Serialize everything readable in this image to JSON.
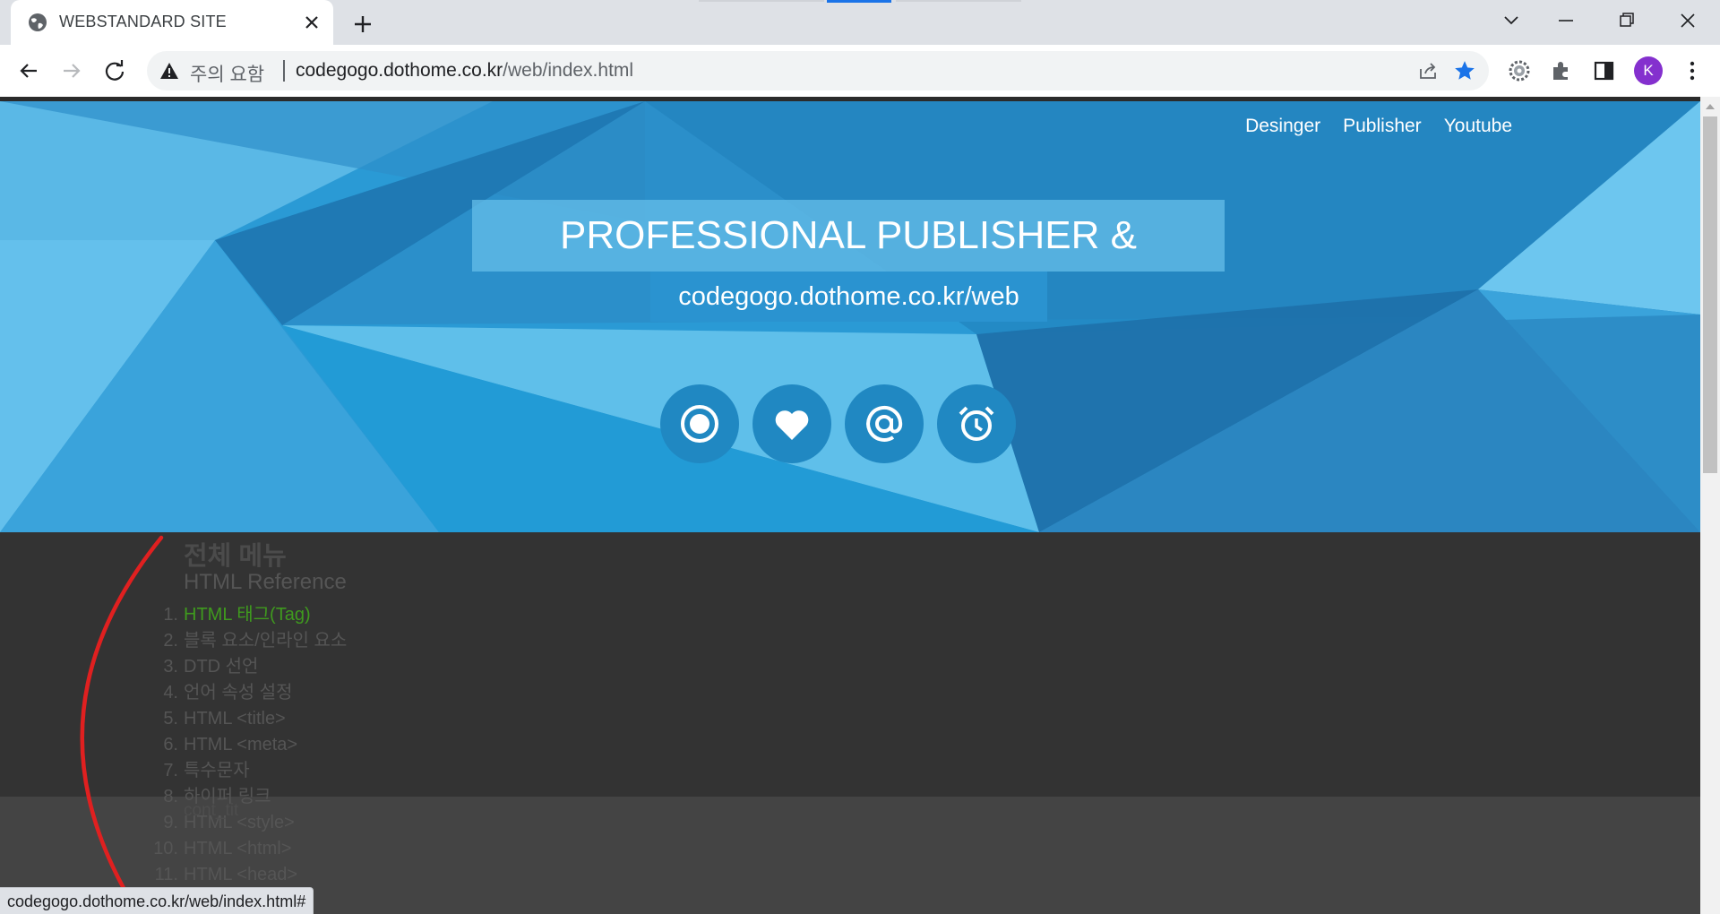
{
  "browser": {
    "tab_title": "WEBSTANDARD SITE",
    "security_label": "주의 요함",
    "url_host": "codegogo.dothome.co.kr",
    "url_path": "/web/index.html",
    "profile_initial": "K",
    "status_url": "codegogo.dothome.co.kr/web/index.html#"
  },
  "page": {
    "nav": [
      "Desinger",
      "Publisher",
      "Youtube"
    ],
    "hero_title": "PROFESSIONAL PUBLISHER & DESIGNER",
    "hero_subtitle": "codegogo.dothome.co.kr/web",
    "circle_icons": [
      "target-icon",
      "heart-icon",
      "at-sign-icon",
      "alarm-clock-icon"
    ],
    "menu_title": "전체 메뉴",
    "reference_title": "HTML Reference",
    "menu_items": [
      {
        "num": "1.",
        "label": "HTML 태그(Tag)"
      },
      {
        "num": "2.",
        "label": "블록 요소/인라인 요소"
      },
      {
        "num": "3.",
        "label": "DTD 선언"
      },
      {
        "num": "4.",
        "label": "언어 속성 설정"
      },
      {
        "num": "5.",
        "label": "HTML <title>"
      },
      {
        "num": "6.",
        "label": "HTML <meta>"
      },
      {
        "num": "7.",
        "label": "특수문자"
      },
      {
        "num": "8.",
        "label": "하이퍼 링크"
      },
      {
        "num": "9.",
        "label": "HTML <style>"
      },
      {
        "num": "10.",
        "label": "HTML <html>"
      },
      {
        "num": "11.",
        "label": "HTML <head>"
      }
    ],
    "cont_tit": "cont_tit"
  },
  "colors": {
    "hero_blue": "#2a9ad5",
    "dark_bg": "#333333",
    "active_link": "#3f9a1e",
    "annotation_red": "#e02020"
  }
}
